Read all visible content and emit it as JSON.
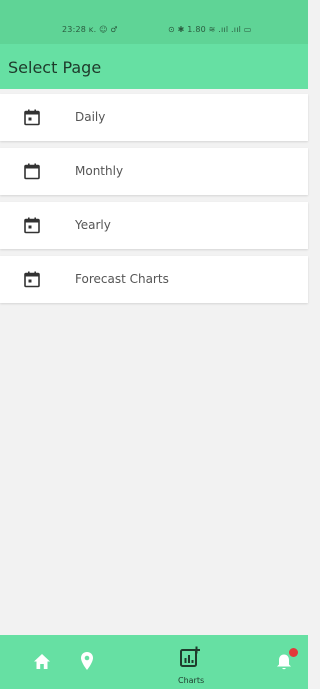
{
  "status_bar": {
    "left_text": "23:28 ᴋ. ☺ ♂",
    "right_text": "⊙ ✱ 1.80 ≋ .ııl .ııl ▭"
  },
  "app_bar": {
    "title": "Select Page"
  },
  "menu": {
    "items": [
      {
        "label": "Daily",
        "icon": "calendar-today-icon"
      },
      {
        "label": "Monthly",
        "icon": "calendar-icon"
      },
      {
        "label": "Yearly",
        "icon": "calendar-today-icon"
      },
      {
        "label": "Forecast Charts",
        "icon": "calendar-today-icon"
      }
    ]
  },
  "bottom_nav": {
    "items": [
      {
        "icon": "home-icon"
      },
      {
        "icon": "location-pin-icon"
      },
      {
        "icon": "chart-add-icon",
        "label": "Charts",
        "active": true
      },
      {
        "icon": "bell-icon"
      }
    ]
  },
  "colors": {
    "primary": "#66e0a3",
    "status_bar": "#5fd496",
    "badge": "#e23a3a",
    "background": "#f2f2f2"
  }
}
